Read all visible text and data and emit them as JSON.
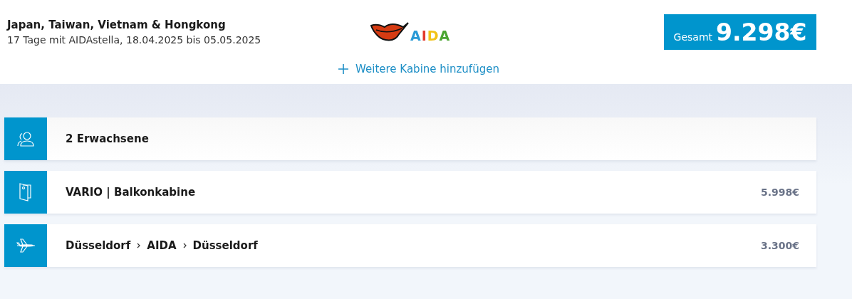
{
  "trip": {
    "title": "Japan, Taiwan, Vietnam & Hongkong",
    "subtitle": "17 Tage mit AIDAstella, 18.04.2025 bis 05.05.2025"
  },
  "logo": {
    "text": "AIDA"
  },
  "total": {
    "label": "Gesamt",
    "amount": "9.298€"
  },
  "add_cabin": {
    "label": "Weitere Kabine hinzufügen"
  },
  "rows": [
    {
      "kind": "travellers",
      "parts": [
        "2 Erwachsene"
      ]
    },
    {
      "kind": "cabin",
      "parts": [
        "VARIO | Balkonkabine"
      ],
      "price": "5.998€"
    },
    {
      "kind": "flight",
      "parts": [
        "Düsseldorf",
        "AIDA",
        "Düsseldorf"
      ],
      "price": "3.300€"
    }
  ]
}
